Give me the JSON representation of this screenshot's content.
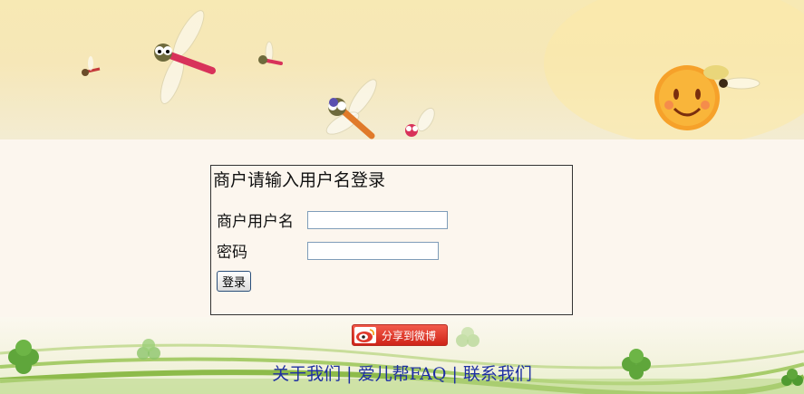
{
  "login": {
    "title": "商户请输入用户名登录",
    "username_label": "商户用户名",
    "username_value": "",
    "password_label": "密码",
    "password_value": "",
    "submit_label": "登录"
  },
  "share": {
    "label": "分享到微博",
    "icon": "weibo-logo-icon"
  },
  "footer": {
    "links": [
      "关于我们",
      "爱儿帮FAQ",
      "联系我们"
    ],
    "separator": "|"
  },
  "colors": {
    "link": "#1e2fa3",
    "page_background": "#fcf6ee",
    "share_button": "#e0392b"
  }
}
